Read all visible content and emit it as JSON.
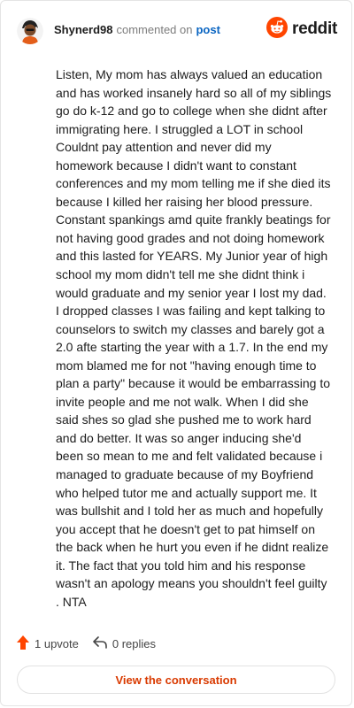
{
  "comment": {
    "username": "Shynerd98",
    "verb": "commented on",
    "target_link": "post",
    "body": "Listen, My mom has always valued an education and has worked insanely hard so all of my siblings go do k-12 and go to college when she didnt after immigrating here. I struggled a LOT in school Couldnt pay attention and never did my homework because I didn't want to constant conferences and my mom telling me if she died its because I killed her raising her blood pressure. Constant spankings amd quite frankly beatings for not having good grades and not doing homework and this lasted for YEARS. My Junior year of high school my mom didn't tell me she didnt think i would graduate and my senior year I lost my dad. I dropped classes I was failing and kept talking to counselors to switch my classes and barely got a 2.0 afte starting the year with a 1.7. In the end my mom blamed me for not \"having enough time to plan a party\" because it would be embarrassing to invite people and me not walk. When I did she said shes so glad she pushed me to work hard and do better. It was so anger inducing she'd been so mean to me and felt validated because i managed to graduate because of my Boyfriend who helped tutor me and actually support me. It was bullshit and I told her as much and hopefully you accept that he doesn't get to pat himself on the back when he hurt you even if he didnt realize it. The fact that you told him and his response wasn't an apology means you shouldn't feel guilty . NTA"
  },
  "brand": {
    "name": "reddit",
    "color": "#ff4500"
  },
  "footer": {
    "upvote_label": "1 upvote",
    "replies_label": "0 replies",
    "upvote_color": "#ff4500"
  },
  "cta_label": "View the conversation",
  "icons": {
    "avatar": "user-avatar",
    "brand": "reddit-logo-icon",
    "upvote": "upvote-arrow-icon",
    "reply": "reply-arrow-icon"
  }
}
